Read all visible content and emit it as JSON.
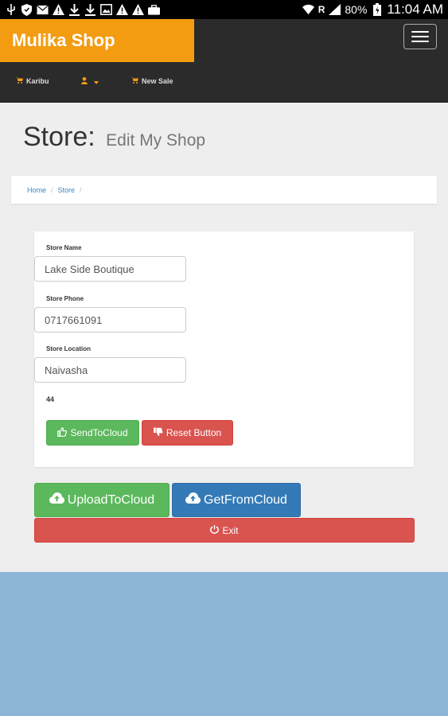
{
  "status_bar": {
    "battery": "80%",
    "time": "11:04 AM",
    "carrier_mark": "R"
  },
  "navbar": {
    "brand": "Mulika Shop",
    "links": [
      {
        "label": "Karibu",
        "icon": "cart-icon"
      },
      {
        "label": "",
        "icon": "user-icon"
      },
      {
        "label": "New Sale",
        "icon": "cart-icon"
      }
    ]
  },
  "page": {
    "title": "Store:",
    "subtitle": "Edit My Shop"
  },
  "breadcrumb": {
    "items": [
      "Home",
      "Store"
    ]
  },
  "form": {
    "store_name_label": "Store Name",
    "store_name_value": "Lake Side Boutique",
    "store_phone_label": "Store Phone",
    "store_phone_value": "0717661091",
    "store_location_label": "Store Location",
    "store_location_value": "Naivasha",
    "count": "44",
    "send_label": "SendToCloud",
    "reset_label": "Reset Button"
  },
  "actions": {
    "upload_label": "UploadToCloud",
    "get_label": "GetFromCloud",
    "exit_label": "Exit"
  },
  "colors": {
    "brand": "#f39c12",
    "navbar": "#2b2b2b",
    "success": "#5cb85c",
    "danger": "#d9534f",
    "primary": "#337ab7",
    "page_bg": "#eeeeee",
    "lower_bg": "#8db5d8"
  }
}
